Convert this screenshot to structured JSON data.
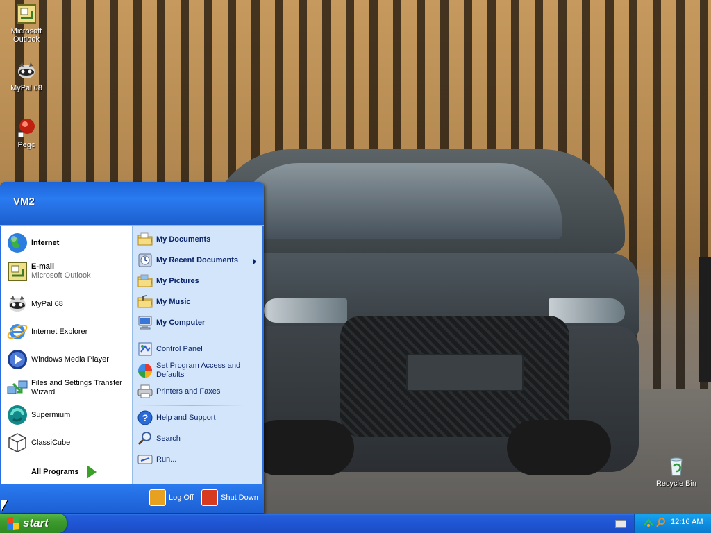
{
  "desktop": {
    "icons": [
      {
        "label": "Microsoft Outlook",
        "icon": "outlook-icon"
      },
      {
        "label": "MyPal 68",
        "icon": "mypal-icon"
      },
      {
        "label": "Pegc",
        "icon": "pegc-icon"
      },
      {
        "label": "Recycle Bin",
        "icon": "recycle-bin-icon"
      }
    ]
  },
  "start_menu": {
    "user_name": "VM2",
    "left": {
      "pinned": [
        {
          "title": "Internet",
          "subtitle": "",
          "icon": "globe-icon"
        },
        {
          "title": "E-mail",
          "subtitle": "Microsoft Outlook",
          "icon": "outlook-icon"
        }
      ],
      "recent": [
        {
          "title": "MyPal 68",
          "icon": "mypal-icon"
        },
        {
          "title": "Internet Explorer",
          "icon": "ie-icon"
        },
        {
          "title": "Windows Media Player",
          "icon": "media-player-icon"
        },
        {
          "title": "Files and Settings Transfer Wizard",
          "icon": "transfer-wizard-icon"
        },
        {
          "title": "Supermium",
          "icon": "supermium-icon"
        },
        {
          "title": "ClassiCube",
          "icon": "classicube-icon"
        }
      ],
      "all_programs_label": "All Programs"
    },
    "right": {
      "places": [
        {
          "title": "My Documents",
          "icon": "folder-icon"
        },
        {
          "title": "My Recent Documents",
          "icon": "recent-docs-icon"
        },
        {
          "title": "My Pictures",
          "icon": "folder-icon"
        },
        {
          "title": "My Music",
          "icon": "folder-icon"
        },
        {
          "title": "My Computer",
          "icon": "computer-icon"
        }
      ],
      "settings": [
        {
          "title": "Control Panel",
          "icon": "control-panel-icon"
        },
        {
          "title": "Set Program Access and Defaults",
          "icon": "program-access-icon"
        },
        {
          "title": "Printers and Faxes",
          "icon": "printer-icon"
        }
      ],
      "tools": [
        {
          "title": "Help and Support",
          "icon": "help-icon"
        },
        {
          "title": "Search",
          "icon": "search-icon"
        },
        {
          "title": "Run...",
          "icon": "run-icon"
        }
      ]
    },
    "footer": {
      "log_off": "Log Off",
      "shut_down": "Shut Down"
    }
  },
  "taskbar": {
    "start_label": "start",
    "clock": "12:16 AM"
  },
  "colors": {
    "start_green": "#3c9a2e",
    "taskbar_blue": "#245edb",
    "tray_blue": "#0f8ee0",
    "menu_right_bg": "#d3e5fa"
  }
}
